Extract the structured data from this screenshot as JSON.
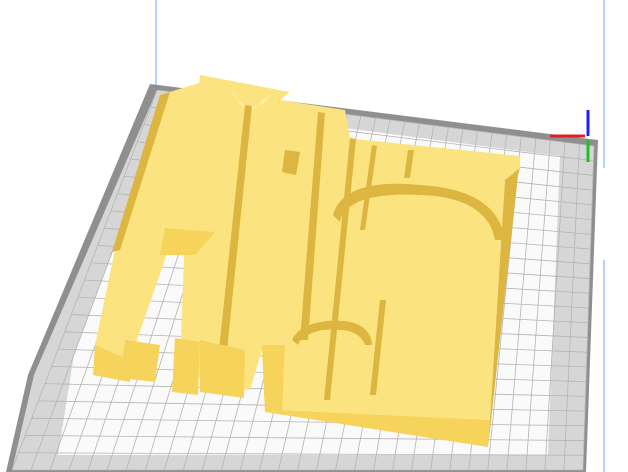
{
  "viewport": {
    "view": "3d-perspective",
    "background_color": "#ffffff"
  },
  "build_plate": {
    "outer_frame_color": "#8f8f8f",
    "border_zone_color": "#d6d6d6",
    "print_area_color": "#fafafa",
    "grid_line_color": "#b4b4b4",
    "volume_edge_color": "#6aa0ff"
  },
  "model": {
    "face_color": "#fbe37f",
    "side_color": "#f6d45c",
    "shadow_color": "#dcb640",
    "highlight_color": "#fff1a8"
  },
  "axis_gizmo": {
    "x_axis_color": "#e02020",
    "y_axis_color": "#2020ff",
    "z_axis_color": "#20c020"
  }
}
